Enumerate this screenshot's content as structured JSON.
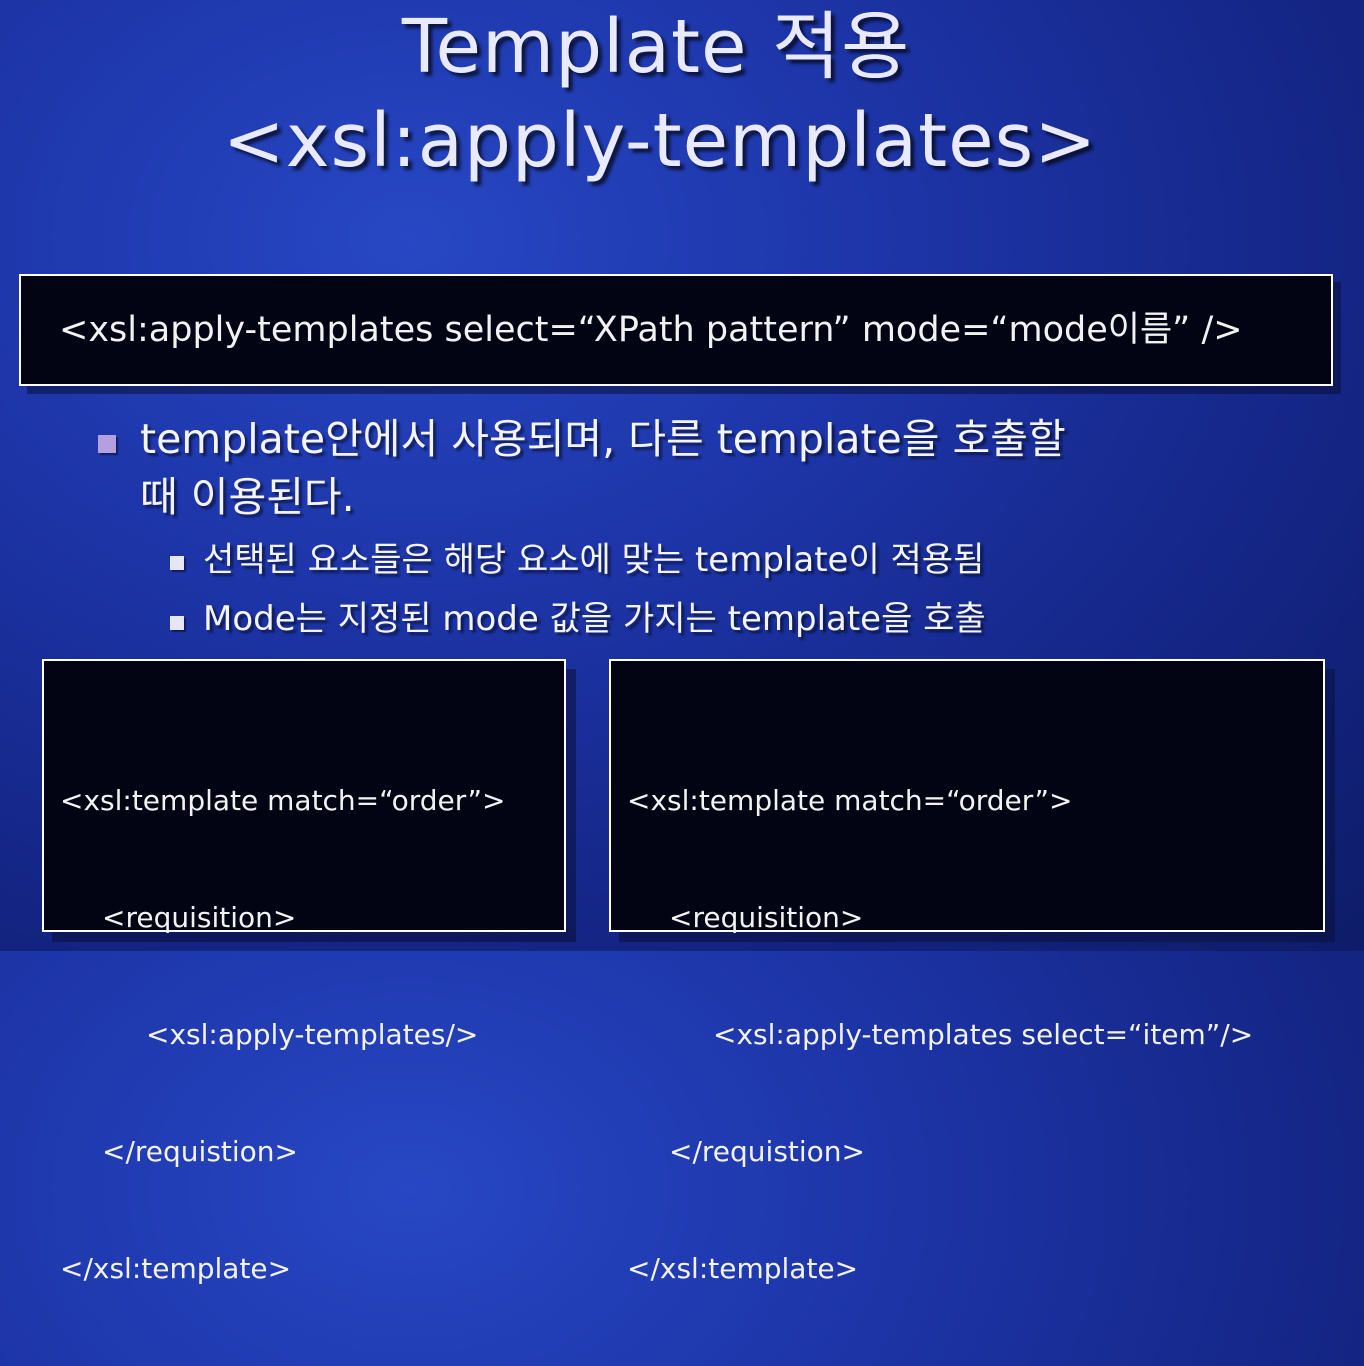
{
  "slide": {
    "title_line1": "Template 적용",
    "title_line2": "<xsl:apply-templates>"
  },
  "syntax": {
    "text": "<xsl:apply-templates select=“XPath pattern” mode=“mode이름” />"
  },
  "bullets": {
    "main": [
      "template안에서 사용되며, 다른 template을 호출할",
      "때 이용된다."
    ],
    "sub": [
      "선택된 요소들은 해당 요소에 맞는 template이 적용됨",
      "Mode는 지정된 mode 값을 가지는 template을 호출"
    ]
  },
  "code_examples": {
    "left": [
      "<xsl:template match=“order”>",
      "<requisition>",
      "<xsl:apply-templates/>",
      "</requistion>",
      "</xsl:template>"
    ],
    "right": [
      "<xsl:template match=“order”>",
      "<requisition>",
      "<xsl:apply-templates select=“item”/>",
      "</requistion>",
      "</xsl:template>"
    ]
  },
  "colors": {
    "background": "#1d35a8",
    "code_box": "#020414",
    "main_bullet": "#b49fe0",
    "sub_bullet": "#e6e6f4"
  }
}
